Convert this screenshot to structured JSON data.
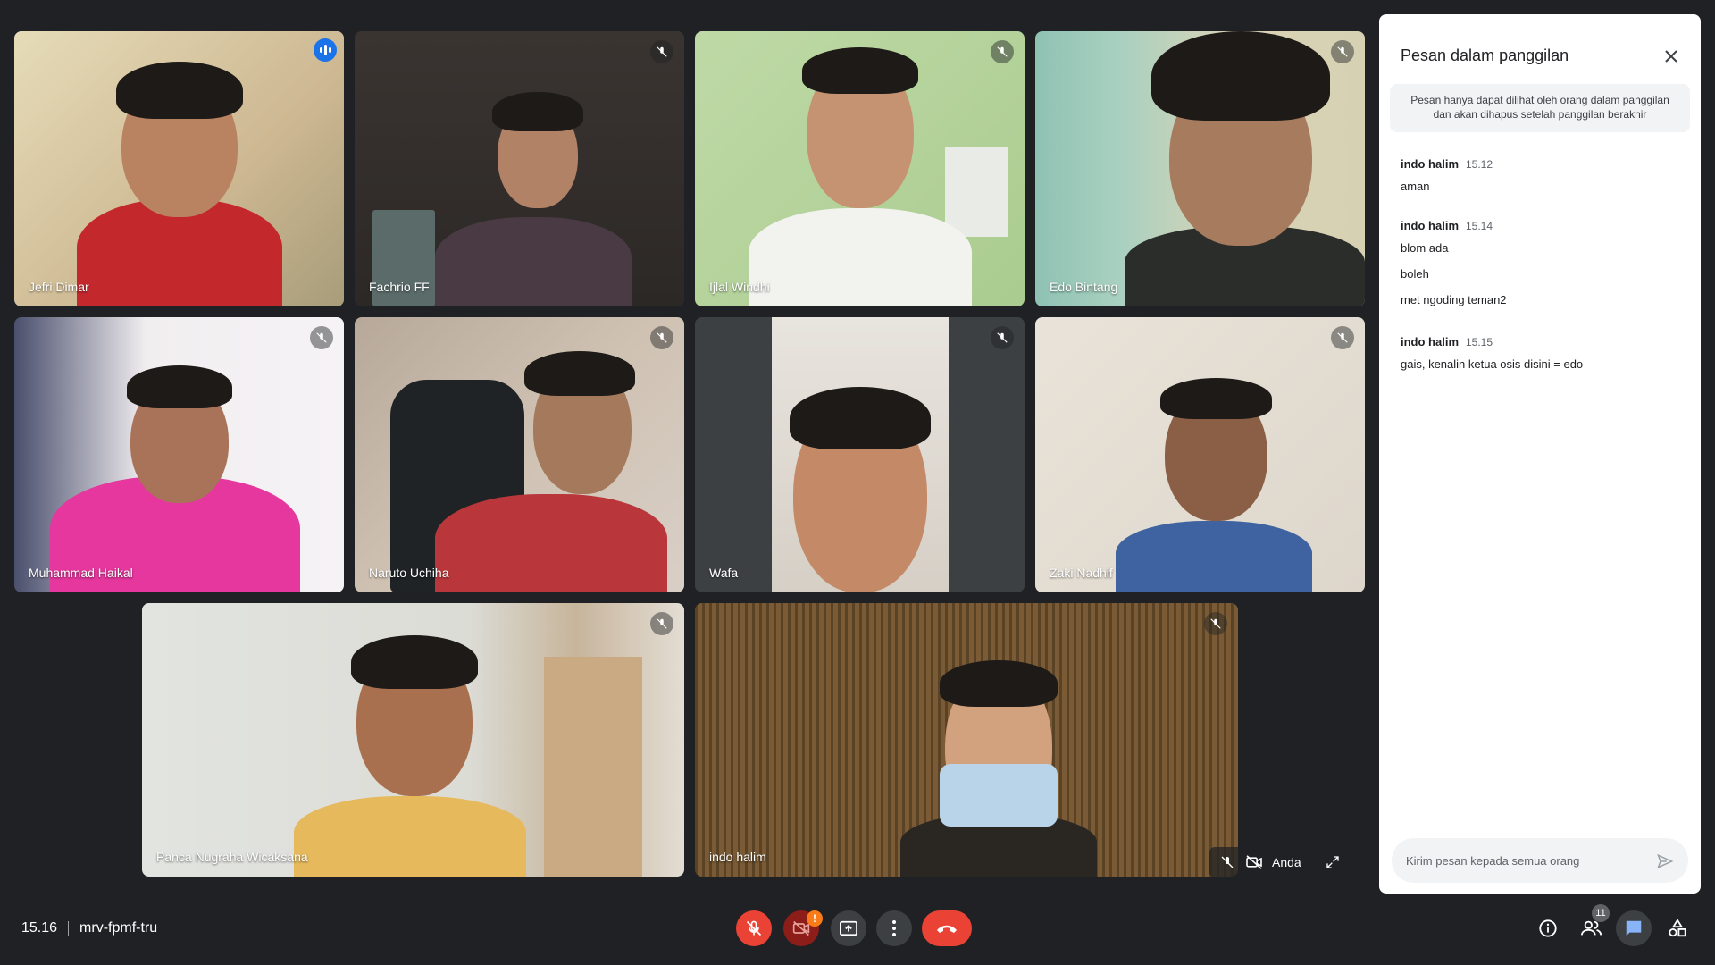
{
  "participants": [
    {
      "name": "Jefri Dimar"
    },
    {
      "name": "Fachrio FF"
    },
    {
      "name": "Ijlal Windhi"
    },
    {
      "name": "Edo Bintang"
    },
    {
      "name": "Muhammad Haikal"
    },
    {
      "name": "Naruto Uchiha"
    },
    {
      "name": "Wafa"
    },
    {
      "name": "Zaki Nadhif"
    },
    {
      "name": "Panca Nugraha Wicaksana"
    },
    {
      "name": "indo halim"
    }
  ],
  "self_view": {
    "label": "Anda"
  },
  "chat": {
    "title": "Pesan dalam panggilan",
    "notice": "Pesan hanya dapat dilihat oleh orang dalam panggilan dan akan dihapus setelah panggilan berakhir",
    "groups": [
      {
        "sender": "indo halim",
        "time": "15.12",
        "messages": [
          "aman"
        ]
      },
      {
        "sender": "indo halim",
        "time": "15.14",
        "messages": [
          "blom ada",
          "boleh",
          "met ngoding teman2"
        ]
      },
      {
        "sender": "indo halim",
        "time": "15.15",
        "messages": [
          "gais, kenalin ketua osis disini = edo"
        ]
      }
    ],
    "input_placeholder": "Kirim pesan kepada semua orang"
  },
  "meeting": {
    "time": "15.16",
    "code": "mrv-fpmf-tru",
    "participant_count": "11",
    "camera_warning": "!"
  },
  "colors": {
    "background": "#202124",
    "accent": "#8ab4f8",
    "end_call": "#ea4335",
    "muted_red": "#ea4335"
  }
}
